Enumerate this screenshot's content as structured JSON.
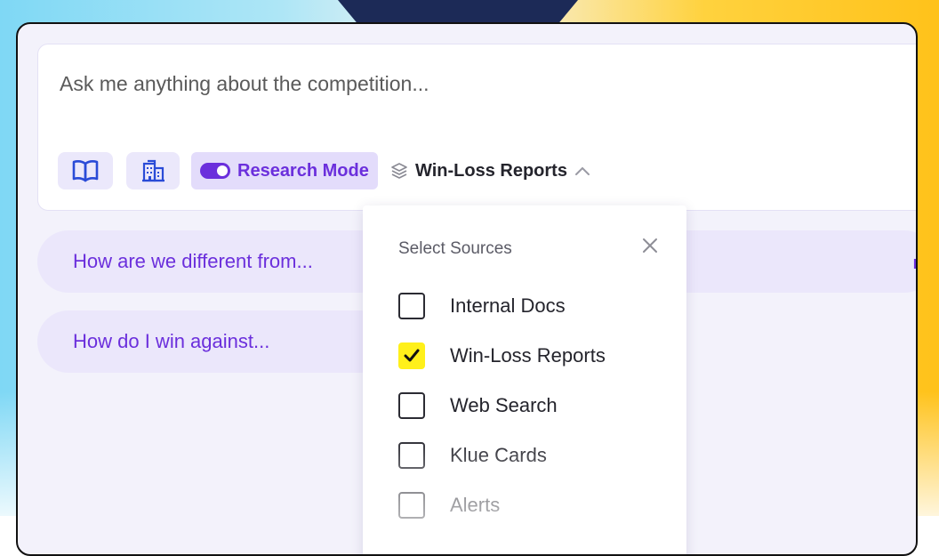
{
  "prompt": {
    "placeholder": "Ask me anything about the competition..."
  },
  "toolbar": {
    "book_icon": "book-icon",
    "building_icon": "building-icon",
    "research_mode_label": "Research Mode",
    "research_mode_on": true,
    "sources_label": "Win-Loss Reports",
    "sources_icon": "layers-icon"
  },
  "suggestions": [
    {
      "label": "How are we different from..."
    },
    {
      "label": "How do I win against..."
    }
  ],
  "dropdown": {
    "title": "Select Sources",
    "options": [
      {
        "label": "Internal Docs",
        "checked": false
      },
      {
        "label": "Win-Loss Reports",
        "checked": true
      },
      {
        "label": "Web Search",
        "checked": false
      },
      {
        "label": "Klue Cards",
        "checked": false
      },
      {
        "label": "Alerts",
        "checked": false
      }
    ]
  },
  "colors": {
    "accent": "#6b2fdc",
    "check": "#fff01a",
    "navy": "#1c2a57",
    "yellow": "#ffc21a",
    "cyan": "#7fd8f5"
  }
}
